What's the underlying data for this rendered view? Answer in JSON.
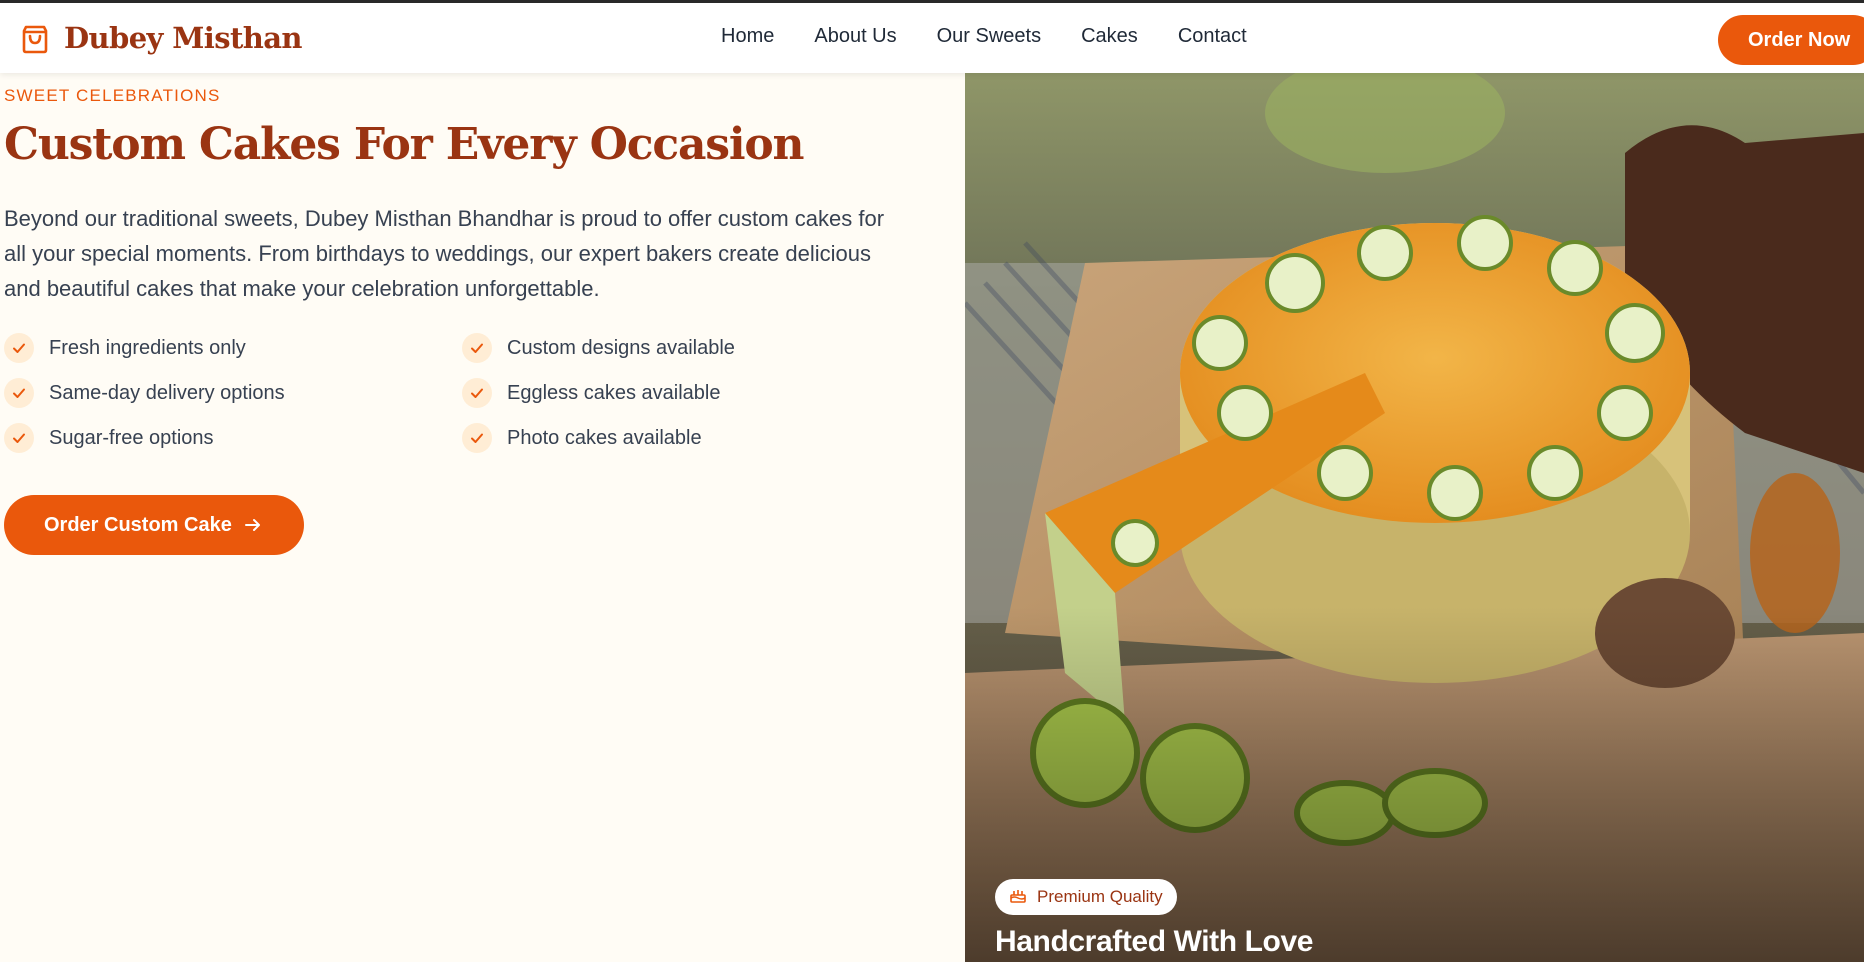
{
  "header": {
    "brand": "Dubey Misthan",
    "nav": [
      "Home",
      "About Us",
      "Our Sweets",
      "Cakes",
      "Contact"
    ],
    "order_button": "Order Now"
  },
  "section": {
    "eyebrow": "SWEET CELEBRATIONS",
    "title": "Custom Cakes For Every Occasion",
    "description": "Beyond our traditional sweets, Dubey Misthan Bhandhar is proud to offer custom cakes for all your special moments. From birthdays to weddings, our expert bakers create delicious and beautiful cakes that make your celebration unforgettable.",
    "features": [
      "Fresh ingredients only",
      "Custom designs available",
      "Same-day delivery options",
      "Eggless cakes available",
      "Sugar-free options",
      "Photo cakes available"
    ],
    "cta_label": "Order Custom Cake"
  },
  "hero": {
    "badge": "Premium Quality",
    "title": "Handcrafted With Love"
  },
  "colors": {
    "accent": "#ea580c",
    "brand": "#9a3412",
    "background": "#fffcf5",
    "check_bg": "#ffedd5"
  },
  "icons": {
    "logo": "shopping-bag-icon",
    "check": "check-icon",
    "arrow": "arrow-right-icon",
    "badge": "cake-icon"
  }
}
